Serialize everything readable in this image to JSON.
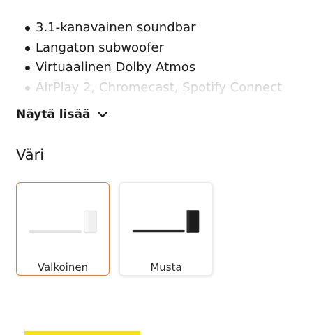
{
  "features": {
    "items": [
      "3.1-kanavainen soundbar",
      "Langaton subwoofer",
      "Virtuaalinen Dolby Atmos",
      "AirPlay 2, Chromecast, Spotify Connect"
    ]
  },
  "show_more": {
    "label": "Näytä lisää",
    "icon": "chevron-down-icon"
  },
  "color_section": {
    "title": "Väri",
    "options": [
      {
        "label": "Valkoinen",
        "selected": true
      },
      {
        "label": "Musta",
        "selected": false
      }
    ]
  },
  "colors": {
    "selected_border": "#e87a2e",
    "accent_bar": "#f4e21c",
    "faded_text": "#c4c4c4"
  }
}
